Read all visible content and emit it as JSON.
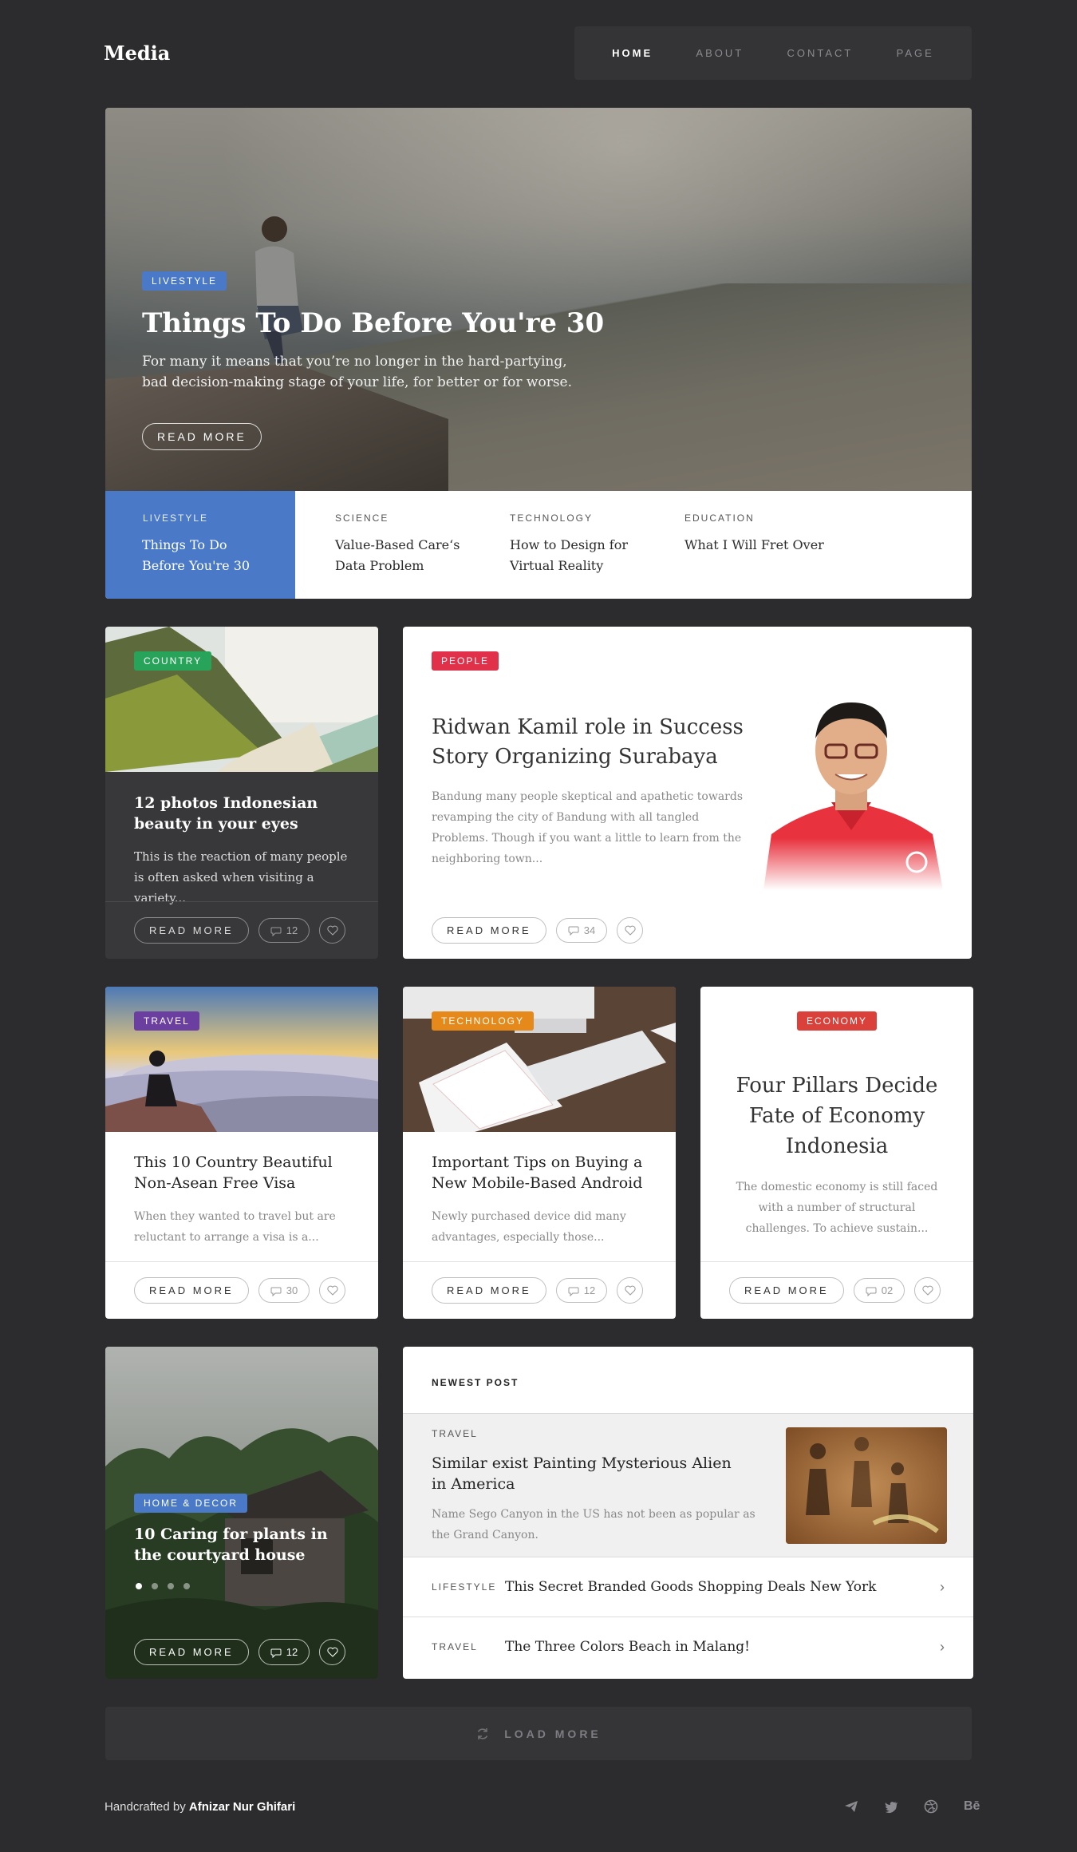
{
  "brand": "Media",
  "nav": {
    "home": "HOME",
    "about": "ABOUT",
    "contact": "CONTACT",
    "page": "PAGE"
  },
  "hero": {
    "category": "LIVESTYLE",
    "title": "Things To Do Before You're 30",
    "text": "For many it means that you’re no longer in the hard-partying, bad decision-making stage of your life, for better or for worse.",
    "button": "READ MORE"
  },
  "strip": [
    {
      "category": "LIVESTYLE",
      "title": "Things To Do Before You're 30"
    },
    {
      "category": "SCIENCE",
      "title": "Value-Based Care‘s Data Problem"
    },
    {
      "category": "TECHNOLOGY",
      "title": "How to Design for Virtual Reality"
    },
    {
      "category": "EDUCATION",
      "title": "What I Will Fret Over"
    }
  ],
  "country_card": {
    "category": "COUNTRY",
    "title": "12 photos Indonesian beauty in your eyes",
    "text": "This is the reaction of many people is often asked when visiting a variety...",
    "button": "READ MORE",
    "comments": "12"
  },
  "people_card": {
    "category": "PEOPLE",
    "title": "Ridwan Kamil role in Success Story Organizing Surabaya",
    "text": "Bandung many people skeptical and apathetic towards revamping the city of Bandung with all tangled Problems. Though if you want a little to learn from the neighboring town...",
    "button": "READ MORE",
    "comments": "34"
  },
  "travel_card": {
    "category": "TRAVEL",
    "title": "This 10 Country Beautiful Non-Asean Free Visa",
    "text": "When they wanted to travel but are reluctant to arrange a visa is a...",
    "button": "READ MORE",
    "comments": "30"
  },
  "tech_card": {
    "category": "TECHNOLOGY",
    "title": "Important Tips on Buying a New Mobile-Based Android",
    "text": "Newly purchased device did many advantages, especially those...",
    "button": "READ MORE",
    "comments": "12"
  },
  "economy_card": {
    "category": "ECONOMY",
    "title": "Four Pillars Decide Fate of Economy Indonesia",
    "text": "The domestic economy is still faced with a number of structural challenges. To achieve sustain...",
    "button": "READ MORE",
    "comments": "02"
  },
  "home_card": {
    "category": "HOME & DECOR",
    "title": "10 Caring for plants in the courtyard house",
    "button": "READ MORE",
    "comments": "12"
  },
  "newest": {
    "heading": "NEWEST POST",
    "featured": {
      "category": "TRAVEL",
      "title": "Similar exist Painting Mysterious Alien in America",
      "text": "Name Sego Canyon in the US has not been as popular as the Grand Canyon."
    },
    "items": [
      {
        "category": "LIFESTYLE",
        "title": "This Secret Branded Goods Shopping Deals New York"
      },
      {
        "category": "TRAVEL",
        "title": "The Three Colors Beach in Malang!"
      }
    ]
  },
  "load_more": "LOAD MORE",
  "footer": {
    "prefix": "Handcrafted by",
    "author": "Afnizar Nur Ghifari"
  },
  "social": [
    "telegram-icon",
    "twitter-icon",
    "dribbble-icon",
    "behance-icon"
  ],
  "colors": {
    "background": "#2c2c2f",
    "livestyle": "#4a79c7",
    "country": "#27a35a",
    "people": "#e0304a",
    "travel": "#6a3fa0",
    "technology": "#e58a1a",
    "economy": "#d9413a",
    "home_decor": "#4a79c7"
  }
}
